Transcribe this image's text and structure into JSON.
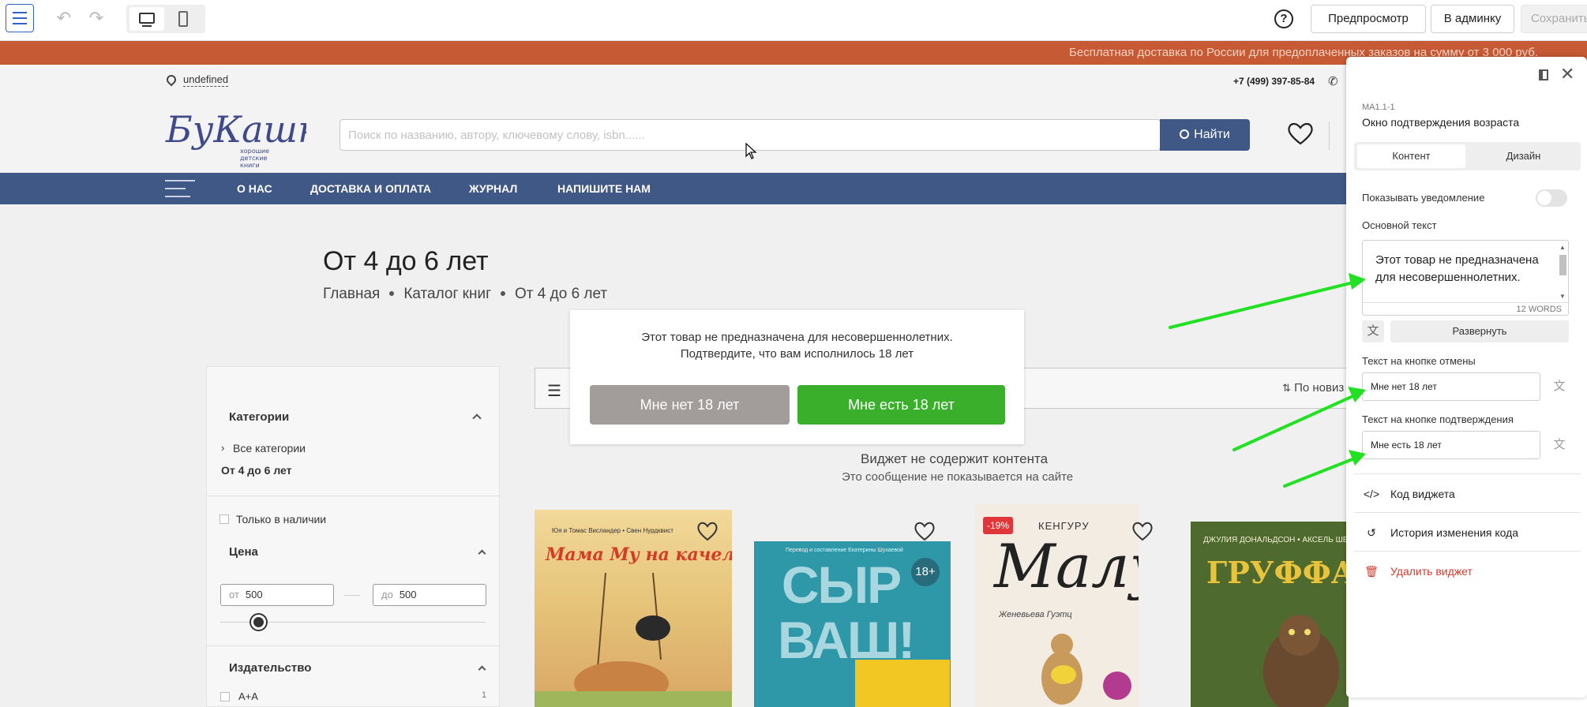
{
  "toolbar": {
    "undo_icon": "undo-icon",
    "redo_icon": "redo-icon",
    "help_label": "?",
    "preview_label": "Предпросмотр",
    "admin_label": "В админку",
    "save_label": "Сохранить"
  },
  "site": {
    "promo": "Бесплатная доставка по России для предоплаченных заказов на сумму от 3 000 руб.",
    "location": "undefined",
    "phone": "+7 (499) 397-85-84",
    "logo_text": "БуКашки",
    "logo_tagline": [
      "хорошие",
      "детские",
      "книги"
    ],
    "search_placeholder": "Поиск по названию, автору, ключевому слову, isbn......",
    "search_button": "Найти",
    "nav": [
      "О НАС",
      "ДОСТАВКА И ОПЛАТА",
      "ЖУРНАЛ",
      "НАПИШИТЕ НАМ"
    ],
    "page_title": "От 4 до 6 лет",
    "breadcrumb": [
      "Главная",
      "Каталог книг",
      "От 4 до 6 лет"
    ],
    "filters": {
      "categories_title": "Категории",
      "all_categories": "Все категории",
      "current_category": "От 4 до 6 лет",
      "in_stock": "Только в наличии",
      "price_title": "Цена",
      "price_from_prefix": "от",
      "price_from": "500",
      "price_to_prefix": "до",
      "price_to": "500",
      "publisher_title": "Издательство",
      "publisher_first": "А+А",
      "publisher_first_count": "1"
    },
    "sort_label": "По новиз",
    "empty_title": "Виджет не содержит контента",
    "empty_note": "Это сообщение не показывается на сайте",
    "books": [
      {
        "cover_top": "Юя и Томас Висландер • Свен Нурдквист",
        "cover_title": "Мама Му на качелях"
      },
      {
        "cover_top": "Перевод и составление Екатерины Шухаевой",
        "cover_title": "СЫР ВАШ!",
        "age_badge": "18+"
      },
      {
        "cover_top": "КЕНГУРУ",
        "cover_title": "Малу",
        "cover_author": "Женевьева Гуэтц",
        "sale_badge": "-19%"
      },
      {
        "cover_top": "ДЖУЛИЯ ДОНАЛЬДСОН • АКСЕЛЬ ШЕФ",
        "cover_title": "ГРУФФАЛО"
      }
    ]
  },
  "modal": {
    "line1": "Этот товар не предназначена для несовершеннолетних.",
    "line2": "Подтвердите, что вам исполнилось 18 лет",
    "cancel": "Мне нет 18 лет",
    "confirm": "Мне есть 18 лет",
    "cancel_color": "#a29c9b",
    "confirm_color": "#3aaf2c"
  },
  "panel": {
    "code": "MA1.1-1",
    "title": "Окно подтверждения возраста",
    "tabs": [
      "Контент",
      "Дизайн"
    ],
    "show_notification": "Показывать уведомление",
    "main_text_label": "Основной текст",
    "main_text": "Этот товар не предназначена для несовершеннолетних.",
    "word_count": "12 WORDS",
    "expand": "Развернуть",
    "cancel_label": "Текст на кнопке отмены",
    "cancel_value": "Мне нет 18 лет",
    "confirm_label": "Текст на кнопке подтверждения",
    "confirm_value": "Мне есть 18 лет",
    "widget_code": "Код виджета",
    "history": "История изменения кода",
    "delete": "Удалить виджет"
  },
  "colors": {
    "promo": "#c65a34",
    "nav": "#3f5886",
    "accent": "#2f62c6",
    "annotation_arrows": "#22e022",
    "danger": "#d53a2e"
  }
}
